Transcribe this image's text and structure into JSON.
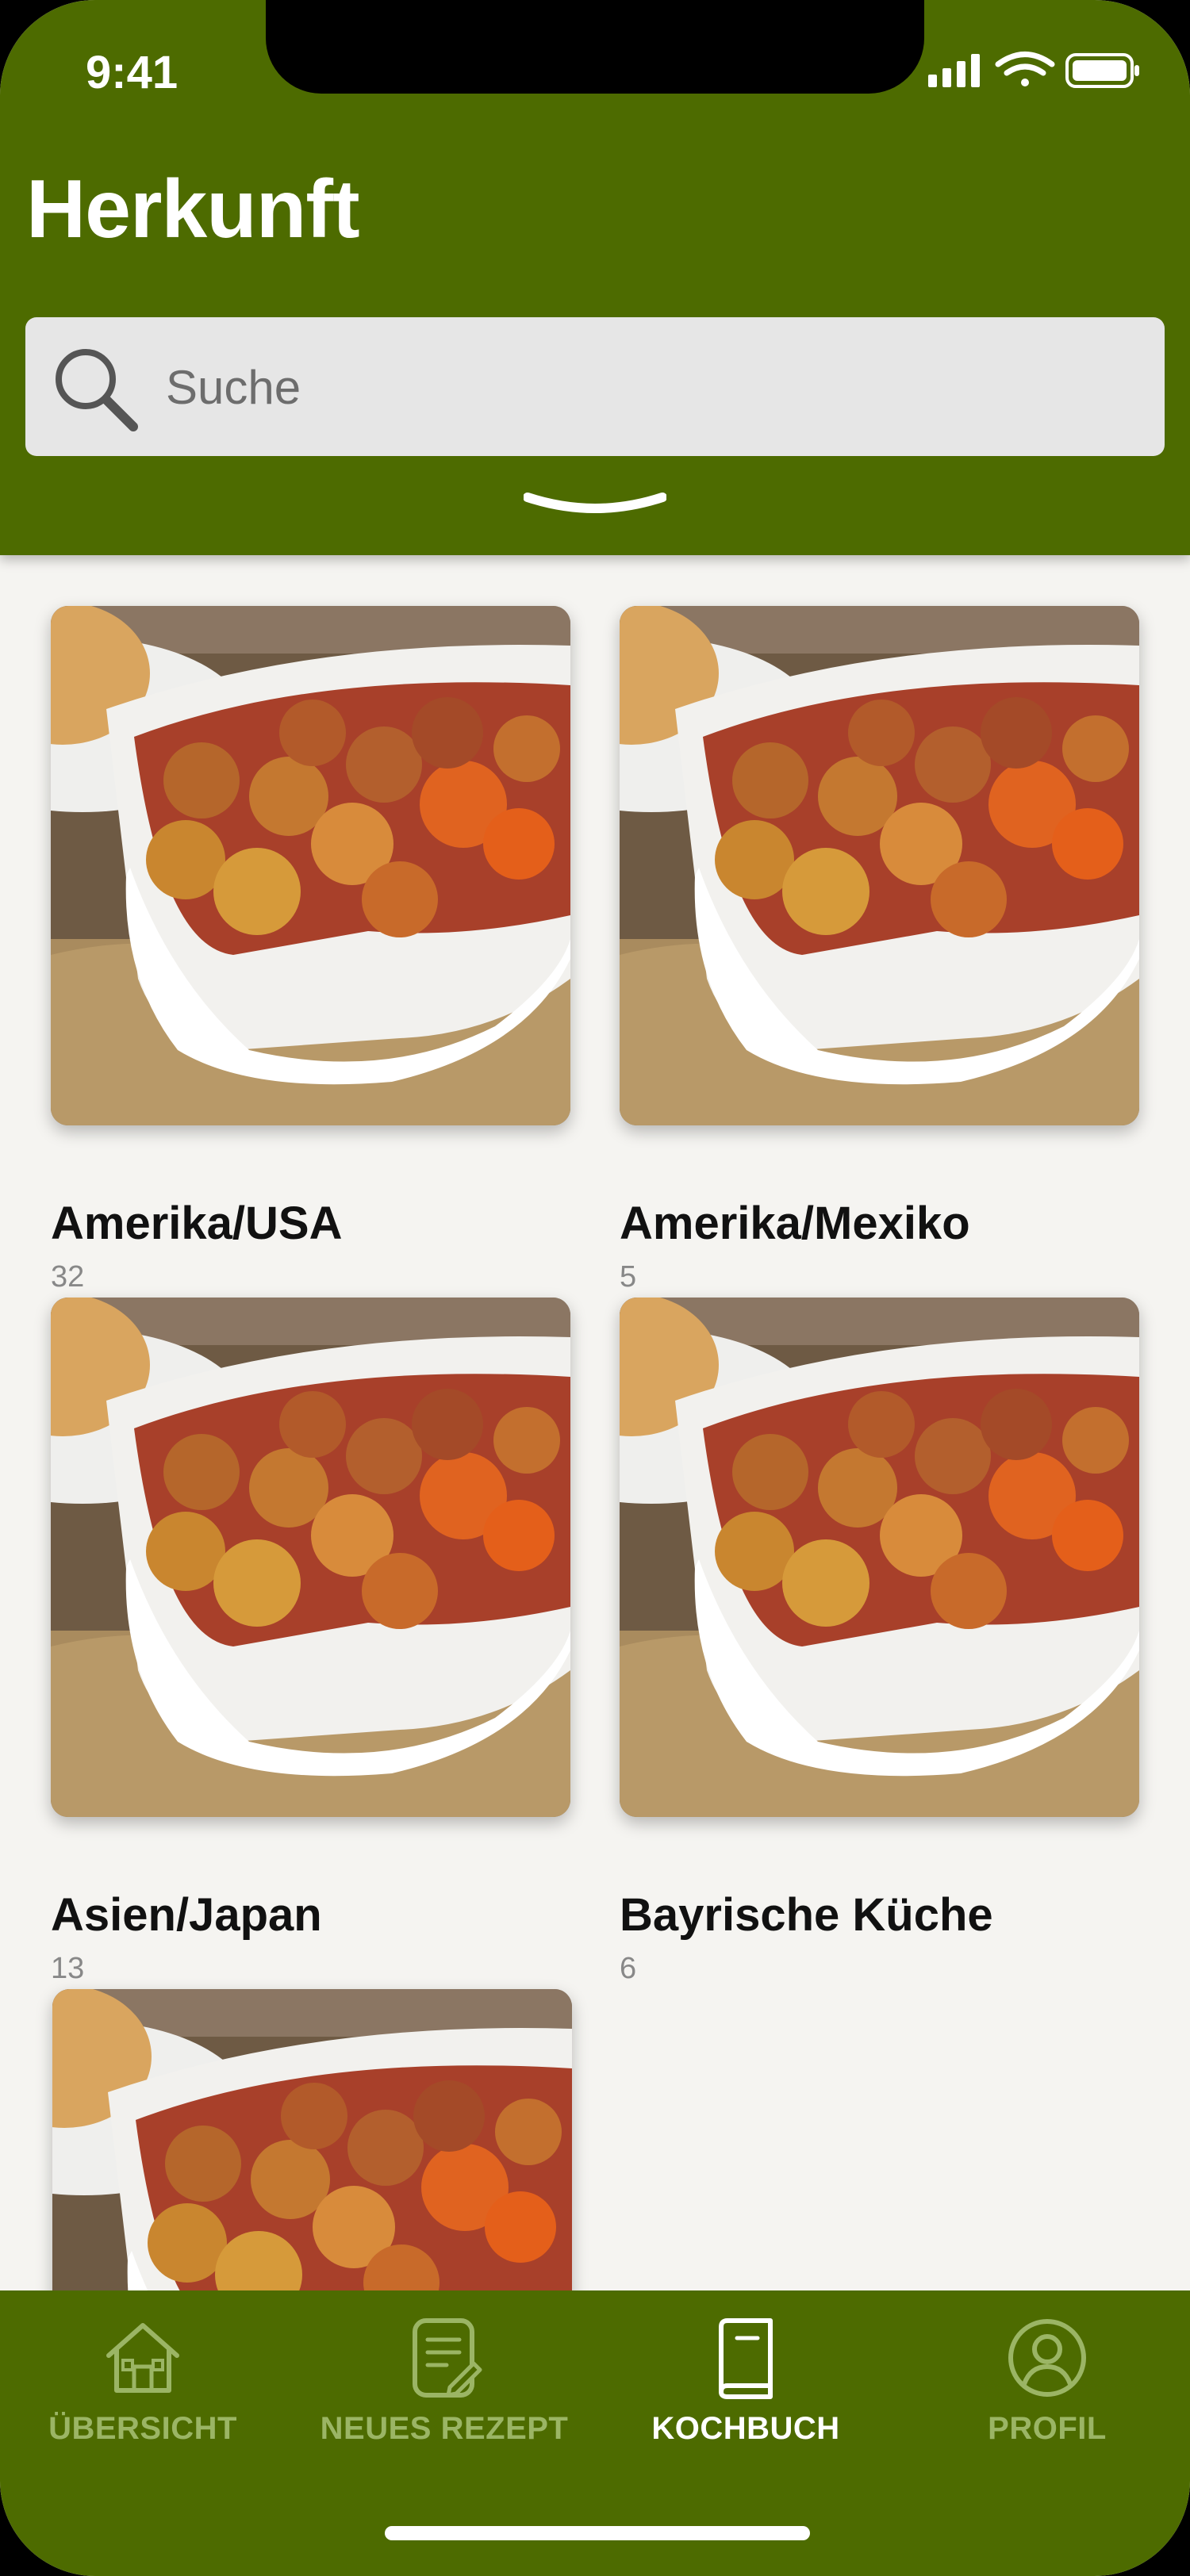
{
  "status_bar": {
    "time": "9:41"
  },
  "header": {
    "title": "Herkunft",
    "search_placeholder": "Suche"
  },
  "categories": [
    {
      "name": "Amerika/USA",
      "count": "32"
    },
    {
      "name": "Amerika/Mexiko",
      "count": "5"
    },
    {
      "name": "Asien/Japan",
      "count": "13"
    },
    {
      "name": "Bayrische Küche",
      "count": "6"
    },
    {
      "name": "",
      "count": ""
    }
  ],
  "tabbar": {
    "tabs": [
      {
        "label": "ÜBERSICHT",
        "icon": "home-icon",
        "active": false
      },
      {
        "label": "NEUES REZEPT",
        "icon": "new-recipe-icon",
        "active": false
      },
      {
        "label": "KOCHBUCH",
        "icon": "cookbook-icon",
        "active": true
      },
      {
        "label": "PROFIL",
        "icon": "profile-icon",
        "active": false
      }
    ]
  },
  "colors": {
    "brand_green": "#4d6b00",
    "inactive_tab": "#9bb565",
    "background": "#f5f4f1"
  }
}
